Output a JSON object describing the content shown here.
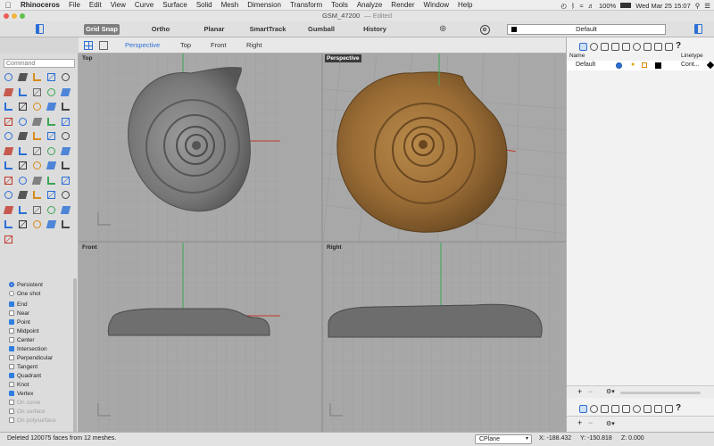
{
  "menubar": {
    "app": "Rhinoceros",
    "items": [
      "File",
      "Edit",
      "View",
      "Curve",
      "Surface",
      "Solid",
      "Mesh",
      "Dimension",
      "Transform",
      "Tools",
      "Analyze",
      "Render",
      "Window",
      "Help"
    ],
    "battery": "100%",
    "clock": "Wed Mar 25  15:07"
  },
  "window": {
    "title": "GSM_47200",
    "edited": "— Edited"
  },
  "toolbar": {
    "toggles": [
      {
        "label": "Grid Snap",
        "on": true
      },
      {
        "label": "Ortho",
        "on": false
      },
      {
        "label": "Planar",
        "on": false
      },
      {
        "label": "SmartTrack",
        "on": false
      },
      {
        "label": "Gumball",
        "on": false
      },
      {
        "label": "History",
        "on": false
      }
    ],
    "layer": "Default"
  },
  "command": {
    "placeholder": "Command"
  },
  "viewport_tabs": [
    "Perspective",
    "Top",
    "Front",
    "Right"
  ],
  "viewports": [
    {
      "name": "Top",
      "active": false
    },
    {
      "name": "Perspective",
      "active": true
    },
    {
      "name": "Front",
      "active": false
    },
    {
      "name": "Right",
      "active": false
    }
  ],
  "osnap": {
    "modes": [
      {
        "label": "Persistent",
        "kind": "radio",
        "on": true
      },
      {
        "label": "One shot",
        "kind": "radio",
        "on": false
      }
    ],
    "items": [
      {
        "label": "End",
        "on": true,
        "enabled": true
      },
      {
        "label": "Near",
        "on": false,
        "enabled": true
      },
      {
        "label": "Point",
        "on": true,
        "enabled": true
      },
      {
        "label": "Midpoint",
        "on": false,
        "enabled": true
      },
      {
        "label": "Center",
        "on": false,
        "enabled": true
      },
      {
        "label": "Intersection",
        "on": true,
        "enabled": true
      },
      {
        "label": "Perpendicular",
        "on": false,
        "enabled": true
      },
      {
        "label": "Tangent",
        "on": false,
        "enabled": true
      },
      {
        "label": "Quadrant",
        "on": true,
        "enabled": true
      },
      {
        "label": "Knot",
        "on": false,
        "enabled": true
      },
      {
        "label": "Vertex",
        "on": true,
        "enabled": true
      },
      {
        "label": "On curve",
        "on": false,
        "enabled": false
      },
      {
        "label": "On surface",
        "on": false,
        "enabled": false
      },
      {
        "label": "On polysurface",
        "on": false,
        "enabled": false
      }
    ]
  },
  "layers": {
    "col_name": "Name",
    "col_linetype": "Linetype",
    "rows": [
      {
        "name": "Default",
        "linetype": "Cont..."
      }
    ]
  },
  "status": {
    "message": "Deleted 120075 faces from 12 meshes.",
    "cplane": "CPlane",
    "x": "X: -188.432",
    "y": "Y: -150.818",
    "z": "Z: 0.000"
  },
  "colors": {
    "accent": "#2b6fd6",
    "viewport_bg": "#a8a8a8",
    "grid": "#9b9b9b",
    "x_axis": "#c0392b",
    "y_axis": "#3aa655",
    "fossil_gray": "#6f6f6f",
    "fossil_tan": "#9a6c35"
  }
}
